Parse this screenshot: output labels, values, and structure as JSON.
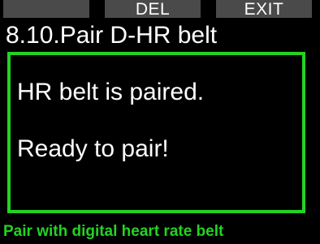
{
  "softkeys": {
    "left_label": "",
    "middle_label": "DEL",
    "right_label": "EXIT"
  },
  "screen": {
    "title": "8.10.Pair D-HR belt",
    "status_line_1": "HR belt is paired.",
    "status_line_2": "Ready to pair!",
    "footer_hint": "Pair with digital heart rate belt"
  },
  "colors": {
    "accent": "#22d322",
    "softkey_bg": "#4a4a4a",
    "background": "#000000",
    "text": "#ffffff"
  }
}
